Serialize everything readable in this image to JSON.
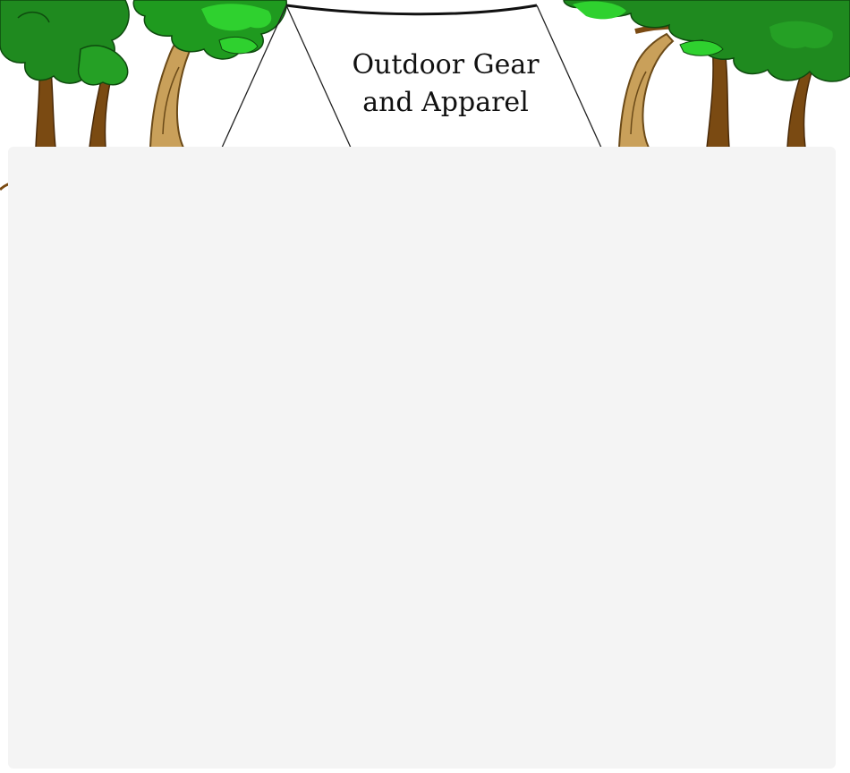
{
  "header": {
    "title_line_1": "Outdoor Gear",
    "title_line_2": "and Apparel"
  },
  "colors": {
    "panel_background": "#f4f4f4",
    "foliage_dark": "#1f8a1f",
    "foliage_light": "#2fd12f",
    "trunk": "#b58a3a",
    "trunk_dark": "#7a4a12"
  },
  "icons": {
    "tent": "tent-icon",
    "trees": "tree-icon"
  }
}
